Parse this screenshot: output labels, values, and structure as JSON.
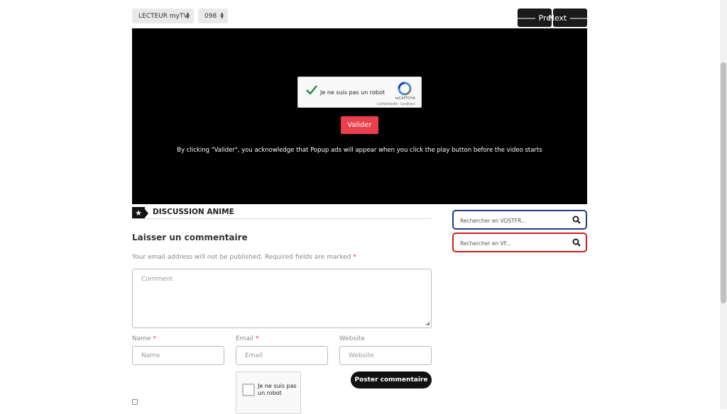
{
  "player_select": {
    "value": "LECTEUR myTV"
  },
  "episode_select": {
    "value": "098"
  },
  "nav": {
    "prev_label": "Prev",
    "next_label": "Next"
  },
  "captcha": {
    "label": "Je ne suis pas un robot",
    "brand": "reCAPTCHA",
    "terms": "Confidentialité - Conditions"
  },
  "validate_label": "Valider",
  "disclaimer": "By clicking \"Valider\", you acknowledge that Popup ads will appear when you click the play button before the video starts",
  "discussion": {
    "title": "DISCUSSION ANIME"
  },
  "comment_form": {
    "heading": "Laisser un commentaire",
    "note": "Your email address will not be published. Required fields are marked",
    "required_mark": "*",
    "comment_placeholder": "Comment",
    "name_label": "Name",
    "name_placeholder": "Name",
    "email_label": "Email",
    "email_placeholder": "Email",
    "website_label": "Website",
    "website_placeholder": "Website",
    "recaptcha_label": "Je ne suis pas un robot",
    "submit_label": "Poster commentaire"
  },
  "sidebar": {
    "search_vostfr_placeholder": "Rechercher en VOSTFR...",
    "search_vf_placeholder": "Rechercher en VF...",
    "vostfr_border_color": "#1f3c8a",
    "vf_border_color": "#d01e1e"
  },
  "colors": {
    "accent": "#ec3f4e"
  }
}
